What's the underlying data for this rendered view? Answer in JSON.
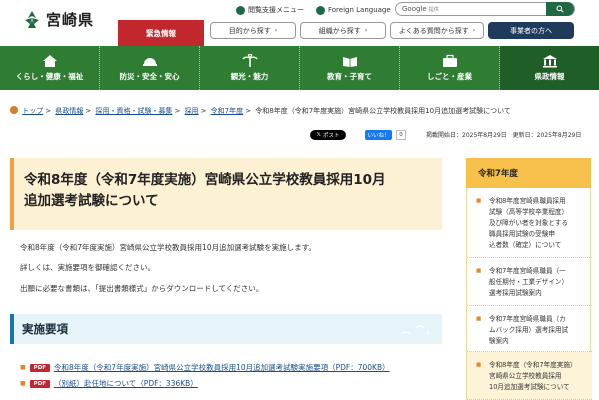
{
  "header": {
    "site_name": "宮崎県",
    "util_accessibility": "閲覧支援メニュー",
    "util_language": "Foreign Language",
    "search_google": "Google",
    "search_placeholder": "提供",
    "emergency": "緊急情報",
    "pills": [
      "目的から探す",
      "組織から探す",
      "よくある質問から探す"
    ],
    "business": "事業者の方へ"
  },
  "nav": {
    "items": [
      "くらし・健康・福祉",
      "防災・安全・安心",
      "観光・魅力",
      "教育・子育て",
      "しごと・産業",
      "県政情報"
    ]
  },
  "breadcrumb": {
    "items": [
      "トップ",
      "県政情報",
      "採用・資格・試験・募集",
      "採用",
      "令和7年度"
    ],
    "current": "令和8年度（令和7年度実施）宮崎県公立学校教員採用10月追加選考試験について"
  },
  "share": {
    "x_post": "ポスト",
    "like": "いいね！",
    "like_count": "0",
    "posted": "掲載開始日：2025年8月29日",
    "updated": "更新日：2025年8月29日"
  },
  "main": {
    "title_line1": "令和8年度（令和7年度実施）宮崎県公立学校教員採用10月",
    "title_line2": "追加選考試験について",
    "para1": "令和8年度（令和7年度実施）宮崎県公立学校教員採用10月追加選考試験を実施します。",
    "para2": "詳しくは、実施要項を御確認ください。",
    "para3": "出願に必要な書類は、「提出書類様式」からダウンロードしてください。",
    "section_heading": "実施要項",
    "pdf_badge": "PDF",
    "pdf_links": [
      "令和8年度（令和7年度実施）宮崎県公立学校教員採用10月追加選考試験実施要項（PDF：700KB）",
      "（別紙）赴任地について（PDF：336KB）"
    ]
  },
  "sidebar": {
    "heading": "令和7年度",
    "items": [
      {
        "lines": [
          "令和8年度宮崎県職員採用",
          "試験（高等学校卒業程度）",
          "及び障がい者を対象とする",
          "職員採用試験の受験申",
          "込者数（確定）について"
        ]
      },
      {
        "lines": [
          "令和7年度宮崎県職員（一",
          "般任期付・工業デザイン）",
          "選考採用試験案内"
        ]
      },
      {
        "lines": [
          "令和7年度宮崎県職員（カ",
          "ムバック採用）選考採用試",
          "験案内"
        ]
      },
      {
        "lines": [
          "令和8年度（令和7年度実施）",
          "宮崎県公立学校教員採用",
          "10月追加選考試験について"
        ]
      }
    ]
  },
  "colors": {
    "nav_green": "#2e7d32",
    "emergency_red": "#c1272d",
    "title_bg": "#fdf1d3",
    "sidebar_head": "#f6c04a",
    "section_bg": "#e6f3f8"
  }
}
